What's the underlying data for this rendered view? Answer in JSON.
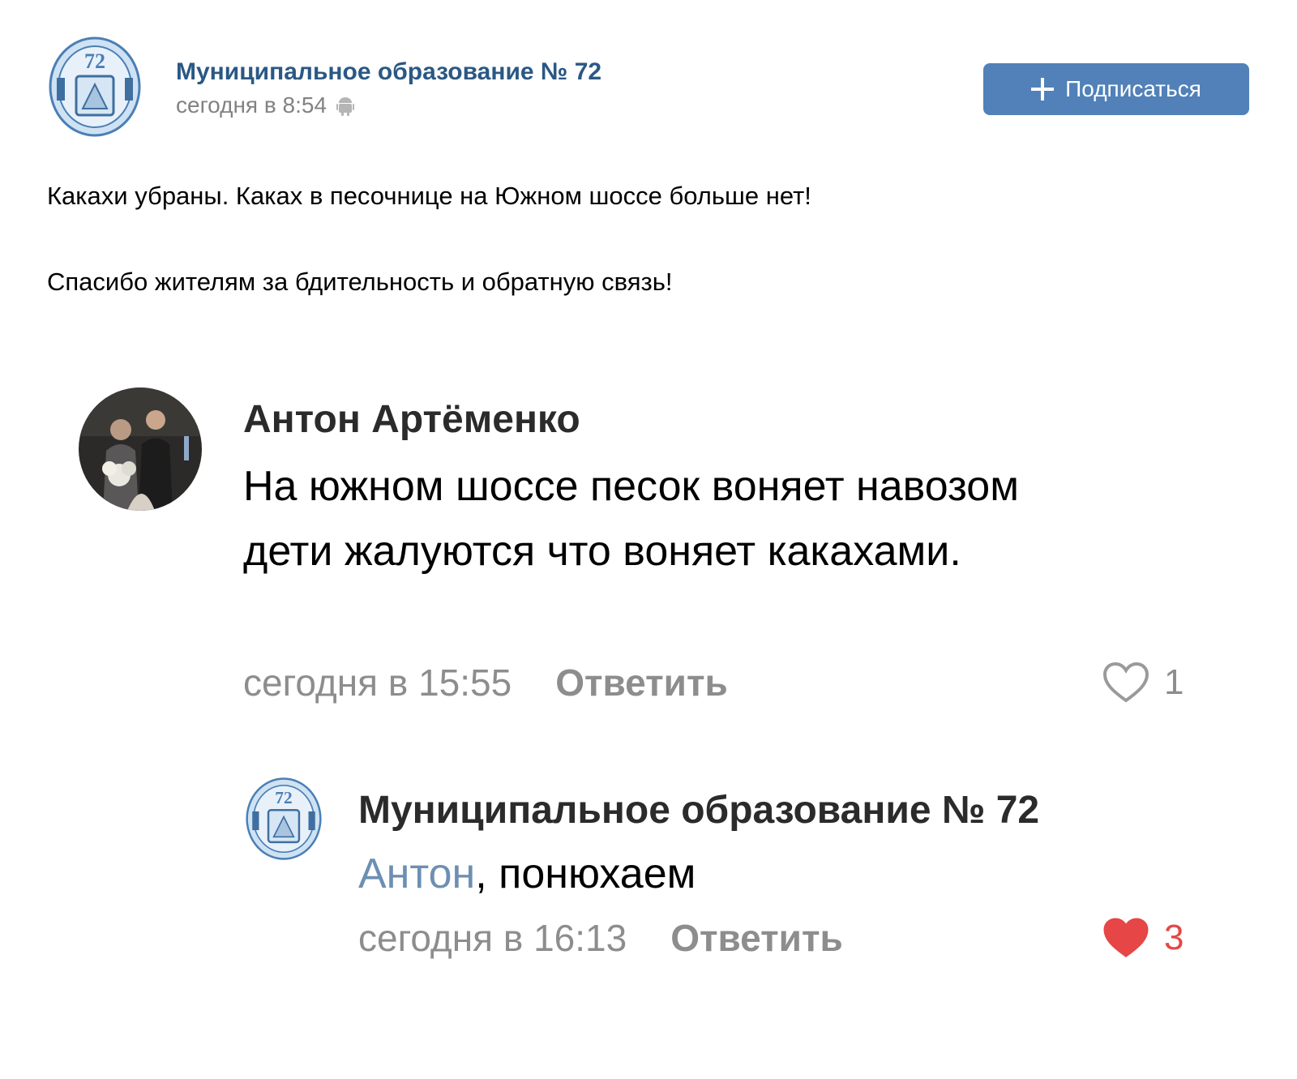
{
  "post": {
    "group_name": "Муниципальное образование № 72",
    "time": "сегодня в 8:54",
    "device_icon": "android-icon",
    "subscribe_label": "Подписаться",
    "text_line_1": "Какахи убраны. Каках в песочнице на Южном шоссе больше нет!",
    "text_line_2": "Спасибо жителям за бдительность и обратную связь!"
  },
  "comments": [
    {
      "author": "Антон Артёменко",
      "text": "На южном шоссе песок воняет навозом дети жалуются что воняет какахами.",
      "time": "сегодня в 15:55",
      "reply_label": "Ответить",
      "likes": "1",
      "liked": false
    },
    {
      "author": "Муниципальное образование № 72",
      "mention": "Антон",
      "text": ", понюхаем",
      "time": "сегодня в 16:13",
      "reply_label": "Ответить",
      "likes": "3",
      "liked": true
    }
  ],
  "colors": {
    "link": "#2a5885",
    "button": "#5181b8",
    "muted": "#828282",
    "like_red": "#e64646",
    "mention": "#6d8fb3"
  }
}
